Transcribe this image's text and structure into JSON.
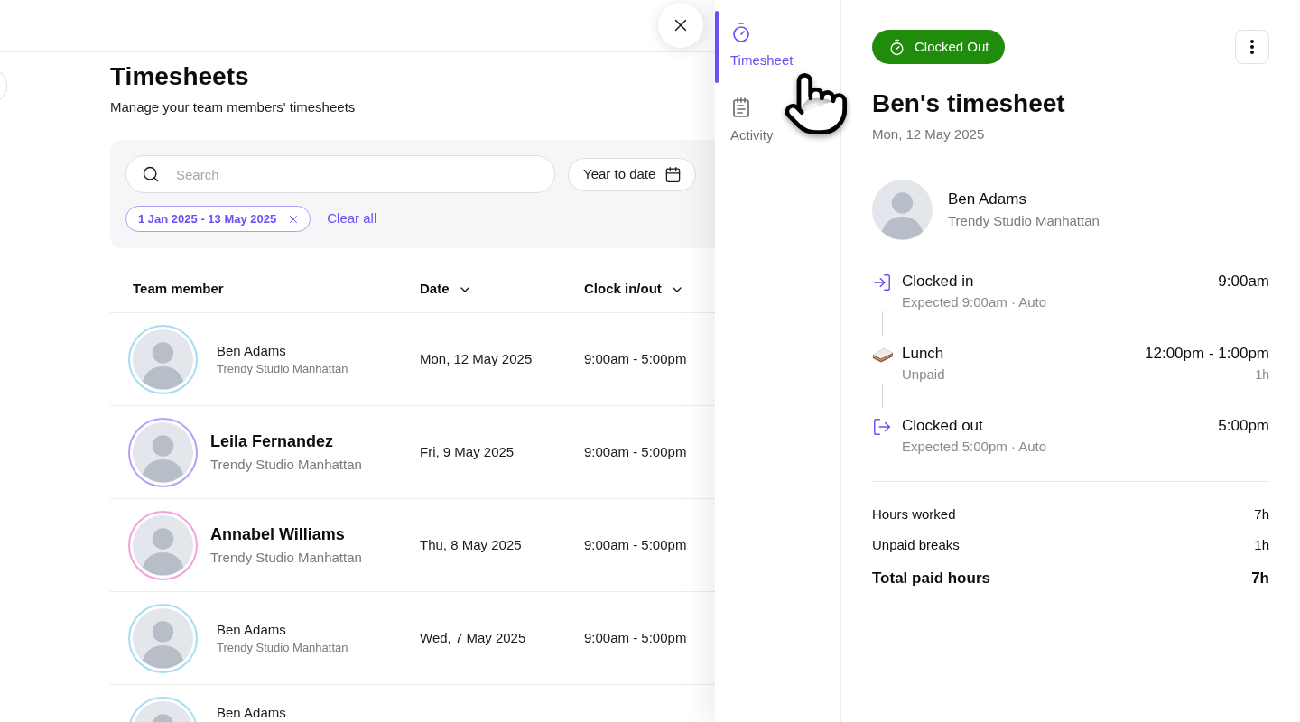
{
  "page": {
    "title": "Timesheets",
    "subtitle": "Manage your team members' timesheets"
  },
  "filters": {
    "search": {
      "placeholder": "Search"
    },
    "date_range_button": "Year to date",
    "active_filters": [
      {
        "label": "1 Jan 2025 - 13 May 2025"
      }
    ],
    "clear_all": "Clear all"
  },
  "table": {
    "columns": [
      {
        "label": "Team member",
        "sortable": false
      },
      {
        "label": "Date",
        "sortable": true
      },
      {
        "label": "Clock in/out",
        "sortable": true
      }
    ],
    "rows": [
      {
        "kind": "compact",
        "name": "Ben Adams",
        "location": "Trendy Studio Manhattan",
        "date": "Mon, 12 May 2025",
        "clock": "9:00am - 5:00pm",
        "color": "#a6dcf2"
      },
      {
        "kind": "expanded",
        "name": "Leila Fernandez",
        "location": "Trendy Studio Manhattan",
        "date": "Fri, 9 May 2025",
        "clock": "9:00am - 5:00pm",
        "color": "#b4a2f8"
      },
      {
        "kind": "expanded",
        "name": "Annabel Williams",
        "location": "Trendy Studio Manhattan",
        "date": "Thu, 8 May 2025",
        "clock": "9:00am - 5:00pm",
        "color": "#f0a3dc"
      },
      {
        "kind": "compact",
        "name": "Ben Adams",
        "location": "Trendy Studio Manhattan",
        "date": "Wed, 7 May 2025",
        "clock": "9:00am - 5:00pm",
        "color": "#a6dcf2"
      },
      {
        "kind": "compact",
        "name": "Ben Adams",
        "color": "#a6dcf2"
      }
    ]
  },
  "drawer": {
    "nav": [
      {
        "kind": "timesheet",
        "label": "Timesheet",
        "selected": true
      },
      {
        "kind": "activity",
        "label": "Activity",
        "selected": false
      }
    ],
    "status": {
      "kind": "clocked_out",
      "label": "Clocked Out"
    },
    "title": "Ben's timesheet",
    "date": "Mon, 12 May 2025",
    "member": {
      "name": "Ben Adams",
      "location": "Trendy Studio Manhattan"
    },
    "timeline": [
      {
        "kind": "clock_in",
        "title": "Clocked in",
        "detail": "Expected 9:00am · Auto",
        "time": "9:00am"
      },
      {
        "kind": "break",
        "title": "Lunch",
        "detail": "Unpaid",
        "time": "12:00pm - 1:00pm",
        "duration": "1h"
      },
      {
        "kind": "clock_out",
        "title": "Clocked out",
        "detail": "Expected 5:00pm · Auto",
        "time": "5:00pm"
      }
    ],
    "summary": [
      {
        "kind": "line",
        "label": "Hours worked",
        "value": "7h"
      },
      {
        "kind": "line",
        "label": "Unpaid breaks",
        "value": "1h"
      },
      {
        "kind": "total",
        "label": "Total paid hours",
        "value": "7h"
      }
    ]
  }
}
